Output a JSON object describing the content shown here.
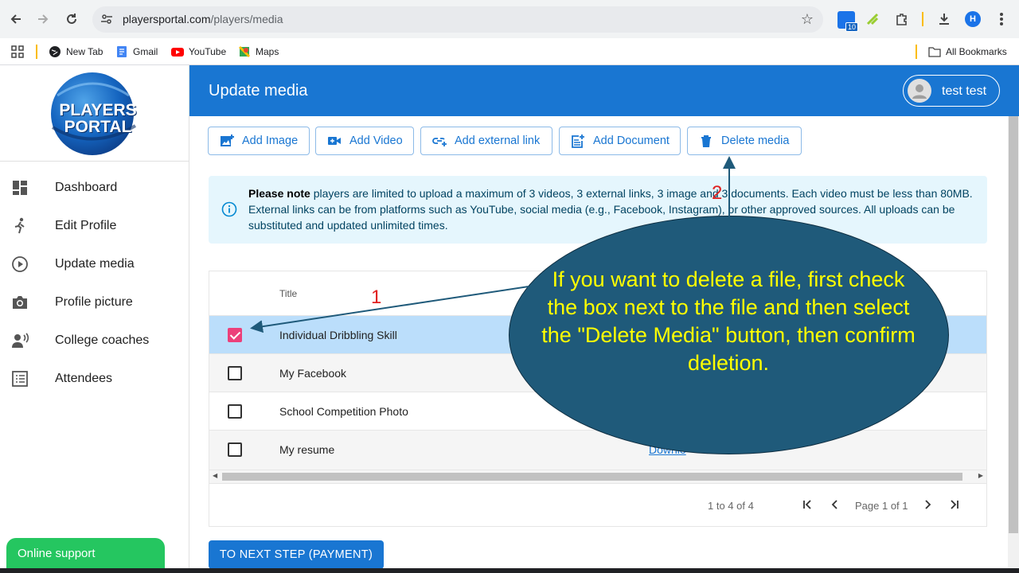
{
  "browser": {
    "url_host": "playersportal.com",
    "url_path": "/players/media",
    "extension_badge": "10",
    "profile_initial": "H",
    "bookmarks": [
      "New Tab",
      "Gmail",
      "YouTube",
      "Maps"
    ],
    "all_bookmarks": "All Bookmarks"
  },
  "sidebar": {
    "logo_line1": "PLAYERS",
    "logo_line2": "PORTAL",
    "items": [
      {
        "label": "Dashboard",
        "icon": "dashboard-icon"
      },
      {
        "label": "Edit Profile",
        "icon": "runner-icon"
      },
      {
        "label": "Update media",
        "icon": "play-circle-icon"
      },
      {
        "label": "Profile picture",
        "icon": "camera-icon"
      },
      {
        "label": "College coaches",
        "icon": "record-voice-icon"
      },
      {
        "label": "Attendees",
        "icon": "list-icon"
      }
    ],
    "online_support": "Online support"
  },
  "header": {
    "title": "Update media",
    "user_name": "test test"
  },
  "toolbar": {
    "add_image": "Add Image",
    "add_video": "Add Video",
    "add_external_link": "Add external link",
    "add_document": "Add Document",
    "delete_media": "Delete media"
  },
  "alert": {
    "bold": "Please note",
    "text": " players are limited to upload a maximum of 3 videos, 3 external links, 3 image and 3 documents. Each video must be less than 80MB. External links can be from platforms such as YouTube, social media (e.g., Facebook, Instagram), or other approved sources. All uploads can be substituted and updated unlimited times."
  },
  "table": {
    "column_title": "Title",
    "rows": [
      {
        "title": "Individual Dribbling Skill",
        "checked": true
      },
      {
        "title": "My Facebook",
        "checked": false
      },
      {
        "title": "School Competition Photo",
        "checked": false
      },
      {
        "title": "My resume",
        "checked": false,
        "link": "Downlo"
      }
    ],
    "count": "1 to 4 of 4",
    "page_label": "Page 1 of 1"
  },
  "next_button": "TO NEXT STEP (PAYMENT)",
  "annotation": {
    "callout": "If you want to delete a file, first check the box next to the file and then select the \"Delete Media\" button, then confirm deletion.",
    "step1": "1",
    "step2": "2"
  },
  "colors": {
    "header_blue": "#1976d2",
    "checkbox_pink": "#ec407a",
    "callout_fill": "#1f5a7a",
    "callout_text": "#ffff00",
    "online_support_green": "#25c660"
  }
}
